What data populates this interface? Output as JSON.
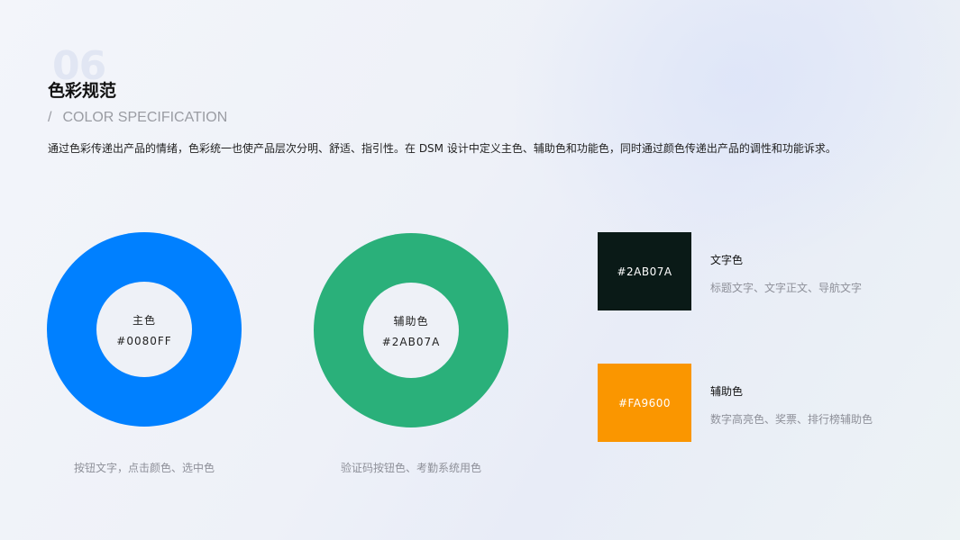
{
  "header": {
    "number": "06",
    "title": "色彩规范",
    "slash": "/",
    "subtitle": "COLOR SPECIFICATION",
    "description": "通过色彩传递出产品的情绪，色彩统一也使产品层次分明、舒适、指引性。在 DSM 设计中定义主色、辅助色和功能色，同时通过颜色传递出产品的调性和功能诉求。"
  },
  "rings": [
    {
      "name": "主色",
      "hex": "#0080FF",
      "color": "#0080FF",
      "caption": "按钮文字，点击颜色、选中色"
    },
    {
      "name": "辅助色",
      "hex": "#2AB07A",
      "color": "#2AB07A",
      "caption": "验证码按钮色、考勤系统用色"
    }
  ],
  "swatches": [
    {
      "label": "#2AB07A",
      "color": "#0A1A17",
      "title": "文字色",
      "desc": "标题文字、文字正文、导航文字"
    },
    {
      "label": "#FA9600",
      "color": "#FA9600",
      "title": "辅助色",
      "desc": "数字高亮色、奖票、排行榜辅助色"
    }
  ],
  "colors": {
    "background": "#EEF1F7",
    "number_watermark": "#E1E6F3",
    "caption": "#8E9099"
  }
}
